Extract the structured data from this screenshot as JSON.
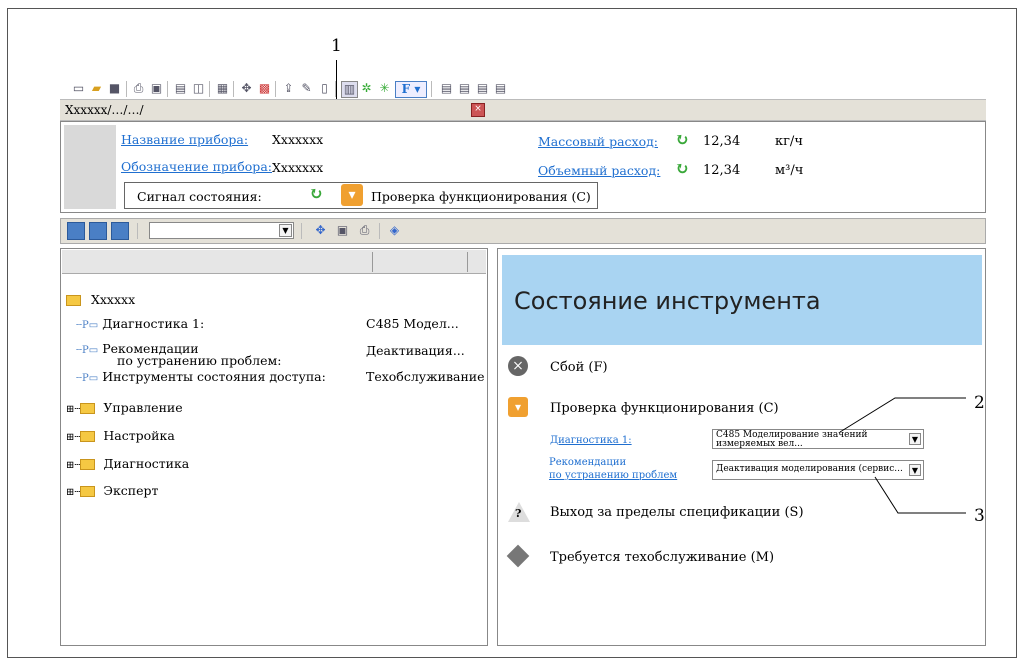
{
  "callouts": {
    "one": "1",
    "two": "2",
    "three": "3"
  },
  "path_bar": {
    "text": "Xxxxxx/…/…/"
  },
  "device_panel": {
    "name_label": "Название прибора:",
    "name_value": "Xxxxxxx",
    "tag_label": "Обозначение прибора:",
    "tag_value": "Xxxxxxx",
    "status_label": "Сигнал состояния:",
    "status_value": "Проверка функционирования (C)",
    "mass_label": "Массовый расход:",
    "mass_value": "12,34",
    "mass_unit": "кг/ч",
    "volume_label": "Объемный расход:",
    "volume_value": "12,34",
    "volume_unit": "м³/ч"
  },
  "toolbar2": {
    "f_button": "F"
  },
  "tree": {
    "root": "Xxxxxx",
    "params": [
      {
        "label": "Диагностика 1:",
        "value": "C485 Модел..."
      },
      {
        "label": "Рекомендации",
        "label2": "по устранению проблем:",
        "value": "Деактивация..."
      },
      {
        "label": "Инструменты состояния доступа:",
        "value": "Техобслуживание"
      }
    ],
    "menus": [
      "Управление",
      "Настройка",
      "Диагностика",
      "Эксперт"
    ]
  },
  "status_panel": {
    "title": "Состояние инструмента",
    "failure": "Сбой (F)",
    "function_check": "Проверка функционирования (C)",
    "diag_link": "Диагностика  1:",
    "diag_value_1": "C485 Моделирование значений",
    "diag_value_2": "измеряемых вел...",
    "remedy_link_1": "Рекомендации",
    "remedy_link_2": "по устранению проблем",
    "remedy_value": "Деактивация моделирования (сервис...",
    "out_of_spec": "Выход за пределы спецификации (S)",
    "maintenance": "Требуется техобслуживание (M)"
  },
  "colors": {
    "accent_blue": "#a9d4f2",
    "link": "#1f6fd0",
    "folder": "#f5c843",
    "refresh": "#3aa83a"
  }
}
